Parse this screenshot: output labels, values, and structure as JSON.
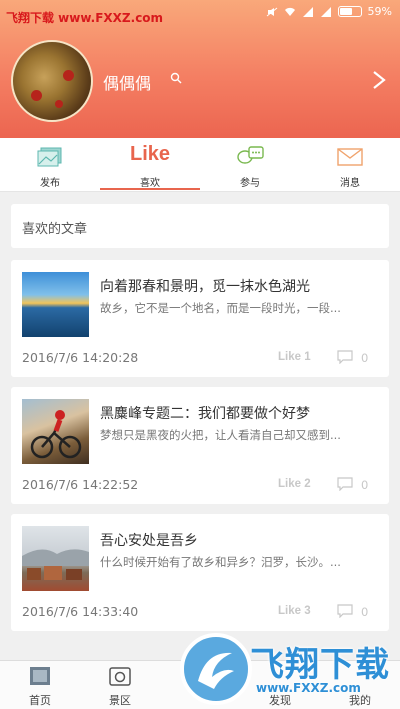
{
  "status_bar": {
    "watermark": "飞翔下载 www.FXXZ.com",
    "battery": "59%"
  },
  "profile": {
    "username": "偶偶偶"
  },
  "tabs": [
    {
      "label": "发布",
      "icon": "photo-icon"
    },
    {
      "label": "喜欢",
      "icon": "like-text-icon",
      "word": "Like",
      "active": true
    },
    {
      "label": "参与",
      "icon": "chat-bubbles-icon"
    },
    {
      "label": "消息",
      "icon": "envelope-icon"
    }
  ],
  "section": {
    "title": "喜欢的文章"
  },
  "articles": [
    {
      "title": "向着那春和景明，觅一抹水色湖光",
      "excerpt": "故乡，它不是一个地名，而是一段时光，一段...",
      "time": "2016/7/6 14:20:28",
      "like": "Like 1",
      "comments": "0"
    },
    {
      "title": "黑麋峰专题二：我们都要做个好梦",
      "excerpt": "梦想只是黑夜的火把，让人看清自己却又感到...",
      "time": "2016/7/6 14:22:52",
      "like": "Like 2",
      "comments": "0"
    },
    {
      "title": "吾心安处是吾乡",
      "excerpt": "什么时候开始有了故乡和异乡？汨罗，长沙。...",
      "time": "2016/7/6 14:33:40",
      "like": "Like 3",
      "comments": "0"
    }
  ],
  "bottom_nav": [
    {
      "label": "首页",
      "icon": "home-picture-icon"
    },
    {
      "label": "景区",
      "icon": "camera-icon"
    },
    {
      "label": "",
      "icon": ""
    },
    {
      "label": "发现",
      "icon": "discover-icon"
    },
    {
      "label": "我的",
      "icon": "me-icon"
    }
  ],
  "watermark_logo": {
    "text": "飞翔下载",
    "url": "www.FXXZ.com"
  },
  "colors": {
    "accent": "#e8654d",
    "header_top": "#f9a87a",
    "header_bottom": "#ec6550"
  }
}
